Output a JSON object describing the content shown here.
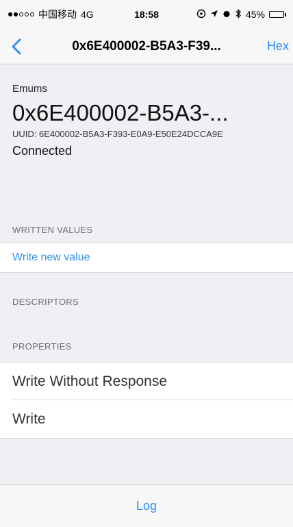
{
  "status_bar": {
    "carrier": "中国移动",
    "network": "4G",
    "time": "18:58",
    "battery_percent": "45%",
    "battery_level": 0.45
  },
  "nav": {
    "title": "0x6E400002-B5A3-F39...",
    "right_button": "Hex"
  },
  "characteristic": {
    "service_name": "Emums",
    "name": "0x6E400002-B5A3-...",
    "uuid": "UUID: 6E400002-B5A3-F393-E0A9-E50E24DCCA9E",
    "status": "Connected"
  },
  "sections": {
    "written_values": "WRITTEN VALUES",
    "write_new_value": "Write new value",
    "descriptors": "DESCRIPTORS",
    "properties": "PROPERTIES"
  },
  "properties": [
    "Write Without Response",
    "Write"
  ],
  "toolbar": {
    "log": "Log"
  },
  "colors": {
    "accent": "#2f8ff0",
    "background": "#efeff4"
  }
}
